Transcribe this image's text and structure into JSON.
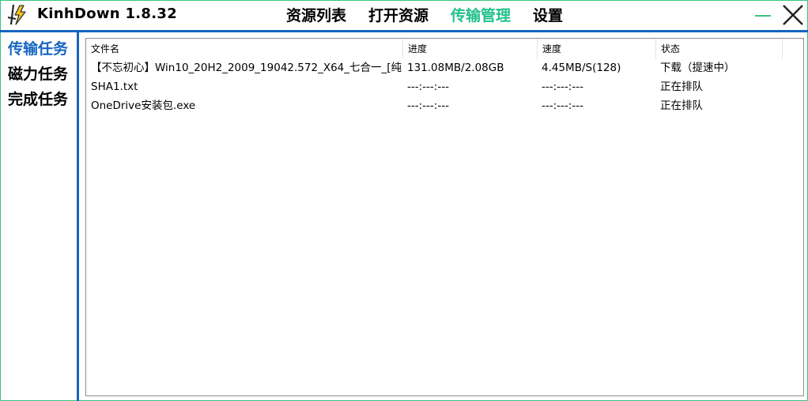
{
  "app": {
    "title": "KinhDown 1.8.32",
    "accent_color": "#22c08a",
    "frame_color": "#3cc37e",
    "divider_color": "#1565c0"
  },
  "nav": [
    {
      "label": "资源列表",
      "active": false
    },
    {
      "label": "打开资源",
      "active": false
    },
    {
      "label": "传输管理",
      "active": true
    },
    {
      "label": "设置",
      "active": false
    }
  ],
  "window_controls": {
    "minimize_icon": "minimize-icon",
    "close_icon": "close-icon"
  },
  "sidebar": {
    "items": [
      {
        "label": "传输任务",
        "active": true
      },
      {
        "label": "磁力任务",
        "active": false
      },
      {
        "label": "完成任务",
        "active": false
      }
    ]
  },
  "table": {
    "columns": [
      "文件名",
      "进度",
      "速度",
      "状态"
    ],
    "rows": [
      {
        "name": "【不忘初心】Win10_20H2_2009_19042.572_X64_七合一_[纯...",
        "progress": "131.08MB/2.08GB",
        "speed": "4.45MB/S(128)",
        "status": "下载（提速中）"
      },
      {
        "name": "SHA1.txt",
        "progress": "---:---:---",
        "speed": "---:---:---",
        "status": "正在排队"
      },
      {
        "name": "OneDrive安装包.exe",
        "progress": "---:---:---",
        "speed": "---:---:---",
        "status": "正在排队"
      }
    ]
  }
}
